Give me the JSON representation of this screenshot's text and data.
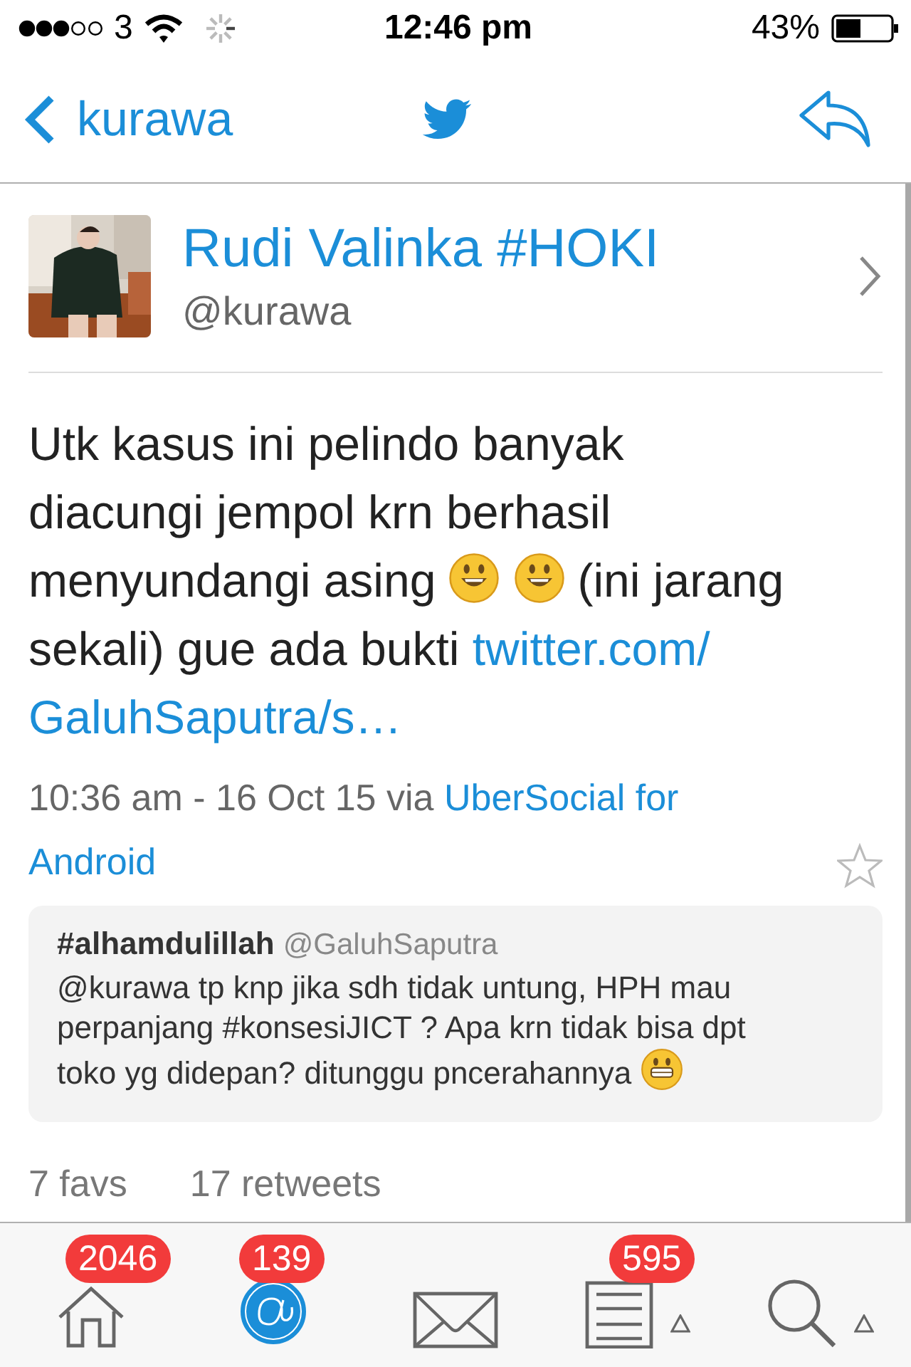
{
  "status_bar": {
    "carrier": "3",
    "time": "12:46 pm",
    "battery_percent": "43%"
  },
  "nav_bar": {
    "back_label": "kurawa"
  },
  "tweet": {
    "author": {
      "name": "Rudi Valinka #HOKI",
      "handle": "@kurawa"
    },
    "body": [
      [
        {
          "kind": "text",
          "text": "Utk kasus ini pelindo banyak"
        }
      ],
      [
        {
          "kind": "text",
          "text": "diacungi jempol krn berhasil"
        }
      ],
      [
        {
          "kind": "text",
          "text": "menyundangi asing"
        },
        {
          "kind": "emoji"
        },
        {
          "kind": "emoji"
        },
        {
          "kind": "text",
          "text": "(ini jarang"
        }
      ],
      [
        {
          "kind": "text",
          "text": "sekali) gue ada bukti"
        },
        {
          "kind": "link",
          "text": "twitter.com/"
        }
      ],
      [
        {
          "kind": "link",
          "text": "GaluhSaputra/s…"
        }
      ]
    ],
    "meta": [
      [
        {
          "kind": "time",
          "text": "10:36 am - 16 Oct 15 via"
        },
        {
          "kind": "link",
          "text": "UberSocial for"
        }
      ],
      [
        {
          "kind": "link",
          "text": "Android"
        }
      ]
    ],
    "favorited": false,
    "quoted": {
      "title": "#alhamdulillah",
      "handle": "@GaluhSaputra",
      "body": [
        {
          "kind": "text",
          "text": "@kurawa tp knp jika sdh tidak untung, HPH mau perpanjang #konsesiJICT ? Apa krn tidak bisa dpt"
        },
        {
          "kind": "text",
          "text": "toko yg didepan? ditunggu pncerahannya"
        },
        {
          "kind": "emoji"
        }
      ]
    },
    "favs": "7 favs",
    "retweets": "17 retweets"
  },
  "tab_bar": [
    {
      "kind": "home",
      "badge": "2046",
      "selected": false
    },
    {
      "kind": "mentions",
      "badge": "139",
      "selected": true
    },
    {
      "kind": "messages",
      "selected": false
    },
    {
      "kind": "lists",
      "badge": "595",
      "selected": false
    },
    {
      "kind": "search",
      "selected": false
    }
  ]
}
